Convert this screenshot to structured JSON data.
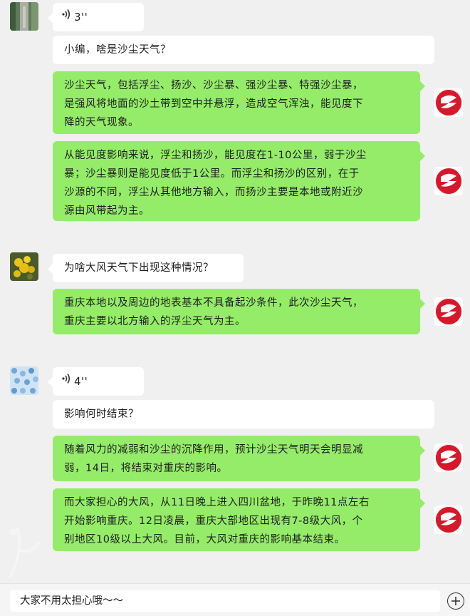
{
  "messages": [
    {
      "side": "left",
      "type": "voice",
      "duration": "3''"
    },
    {
      "side": "left",
      "type": "text",
      "text": "小编，啥是沙尘天气？"
    },
    {
      "side": "right",
      "type": "text",
      "lines": [
        "沙尘天气，包括浮尘、扬沙、沙尘暴、强沙尘暴、特强沙尘暴，",
        "是强风将地面的沙土带到空中并悬浮，造成空气浑浊，能见度下",
        "降的天气现象。"
      ]
    },
    {
      "side": "right",
      "type": "text",
      "lines": [
        "从能见度影响来说，浮尘和扬沙，能见度在1-10公里，弱于沙尘",
        "暴；沙尘暴则是能见度低于1公里。而浮尘和扬沙的区别，在于",
        "沙源的不同，浮尘从其他地方输入，而扬沙主要是本地或附近沙",
        "源由风带起为主。"
      ]
    },
    {
      "side": "left",
      "type": "text",
      "text": "为啥大风天气下出现这种情况？"
    },
    {
      "side": "right",
      "type": "text",
      "lines": [
        "重庆本地以及周边的地表基本不具备起沙条件，此次沙尘天气，",
        "重庆主要以北方输入的浮尘天气为主。"
      ]
    },
    {
      "side": "left",
      "type": "voice",
      "duration": "4''"
    },
    {
      "side": "left",
      "type": "text",
      "text": "影响何时结束？"
    },
    {
      "side": "right",
      "type": "text",
      "lines": [
        "随着风力的减弱和沙尘的沉降作用，预计沙尘天气明天会明显减",
        "弱，14日，将结束对重庆的影响。"
      ]
    },
    {
      "side": "right",
      "type": "text",
      "lines": [
        "而大家担心的大风，从11日晚上进入四川盆地，于昨晚11点左右",
        "开始影响重庆。12日凌晨，重庆大部地区出现有7-8级大风，个",
        "别地区10级以上大风。目前，大风对重庆的影响基本结束。"
      ]
    }
  ],
  "input": {
    "text": "大家不用太担心哦～～"
  },
  "icons": {
    "voice": "sound-wave-icon",
    "plus": "plus-circle-icon",
    "right_avatar": "brand-logo-icon"
  },
  "colors": {
    "right_bubble": "#95ec69",
    "left_bubble": "#ffffff",
    "background": "#f0f0f0",
    "logo_red": "#d7182a"
  }
}
